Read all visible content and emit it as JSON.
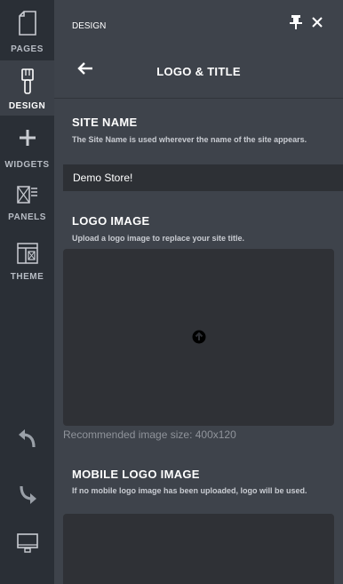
{
  "rail": {
    "items": [
      {
        "label": "PAGES",
        "icon": "page-icon"
      },
      {
        "label": "DESIGN",
        "icon": "brush-icon"
      },
      {
        "label": "WIDGETS",
        "icon": "plus-icon"
      },
      {
        "label": "PANELS",
        "icon": "panels-icon"
      },
      {
        "label": "THEME",
        "icon": "theme-icon"
      }
    ],
    "bottom_icons": [
      "undo-icon",
      "redo-icon",
      "monitor-icon"
    ]
  },
  "header": {
    "title": "DESIGN"
  },
  "subheader": {
    "title": "LOGO & TITLE"
  },
  "site_name": {
    "title": "SITE NAME",
    "description": "The Site Name is used wherever the name of the site appears.",
    "value": "Demo Store!"
  },
  "logo_image": {
    "title": "LOGO IMAGE",
    "description": "Upload a logo image to replace your site title.",
    "hint": "Recommended image size: 400x120"
  },
  "mobile_logo": {
    "title": "MOBILE LOGO IMAGE",
    "description": "If no mobile logo image has been uploaded, logo will be used."
  }
}
